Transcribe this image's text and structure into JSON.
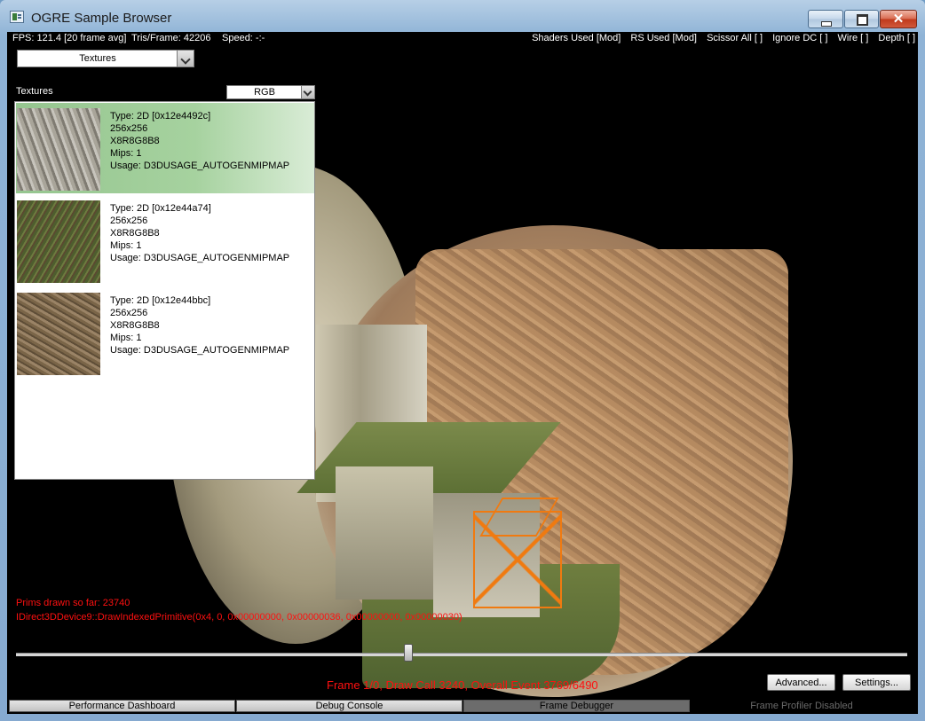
{
  "window": {
    "title": "OGRE Sample Browser",
    "minimize": "",
    "maximize": "",
    "close": "✕"
  },
  "hud": {
    "fps": "FPS: 121.4 [20 frame avg]",
    "tris": "Tris/Frame:  42206",
    "speed": "Speed:  -:-",
    "flags": [
      "Shaders Used [Mod]",
      "RS Used [Mod]",
      "Scissor All [ ]",
      "Ignore DC [ ]",
      "Wire [ ]",
      "Depth [ ]"
    ]
  },
  "textures_combo": {
    "value": "Textures"
  },
  "panel": {
    "label": "Textures",
    "channel_combo": {
      "value": "RGB"
    },
    "items": [
      {
        "type": "Type: 2D [0x12e4492c]",
        "size": "256x256",
        "format": "X8R8G8B8",
        "mips": "Mips: 1",
        "usage": "Usage: D3DUSAGE_AUTOGENMIPMAP",
        "selected": true
      },
      {
        "type": "Type: 2D [0x12e44a74]",
        "size": "256x256",
        "format": "X8R8G8B8",
        "mips": "Mips: 1",
        "usage": "Usage: D3DUSAGE_AUTOGENMIPMAP",
        "selected": false
      },
      {
        "type": "Type: 2D [0x12e44bbc]",
        "size": "256x256",
        "format": "X8R8G8B8",
        "mips": "Mips: 1",
        "usage": "Usage: D3DUSAGE_AUTOGENMIPMAP",
        "selected": false
      }
    ]
  },
  "debug": {
    "prims": "Prims drawn so far: 23740",
    "call": "IDirect3DDevice9::DrawIndexedPrimitive(0x4, 0, 0x00000000, 0x00000036, 0x00000000, 0x00000030)",
    "frame_status": "Frame 1/0, Draw Call 3240, Overall Event 3769/6490",
    "timeline_position": 0.44
  },
  "buttons": {
    "advanced": "Advanced...",
    "settings": "Settings..."
  },
  "tabs": [
    "Performance Dashboard",
    "Debug Console",
    "Frame Debugger"
  ],
  "active_tab": "Frame Debugger",
  "profiler": "Frame Profiler Disabled",
  "colors": {
    "debug_text": "#ff1010",
    "selection": "#a6d29f",
    "wireframe": "#f07a10"
  }
}
